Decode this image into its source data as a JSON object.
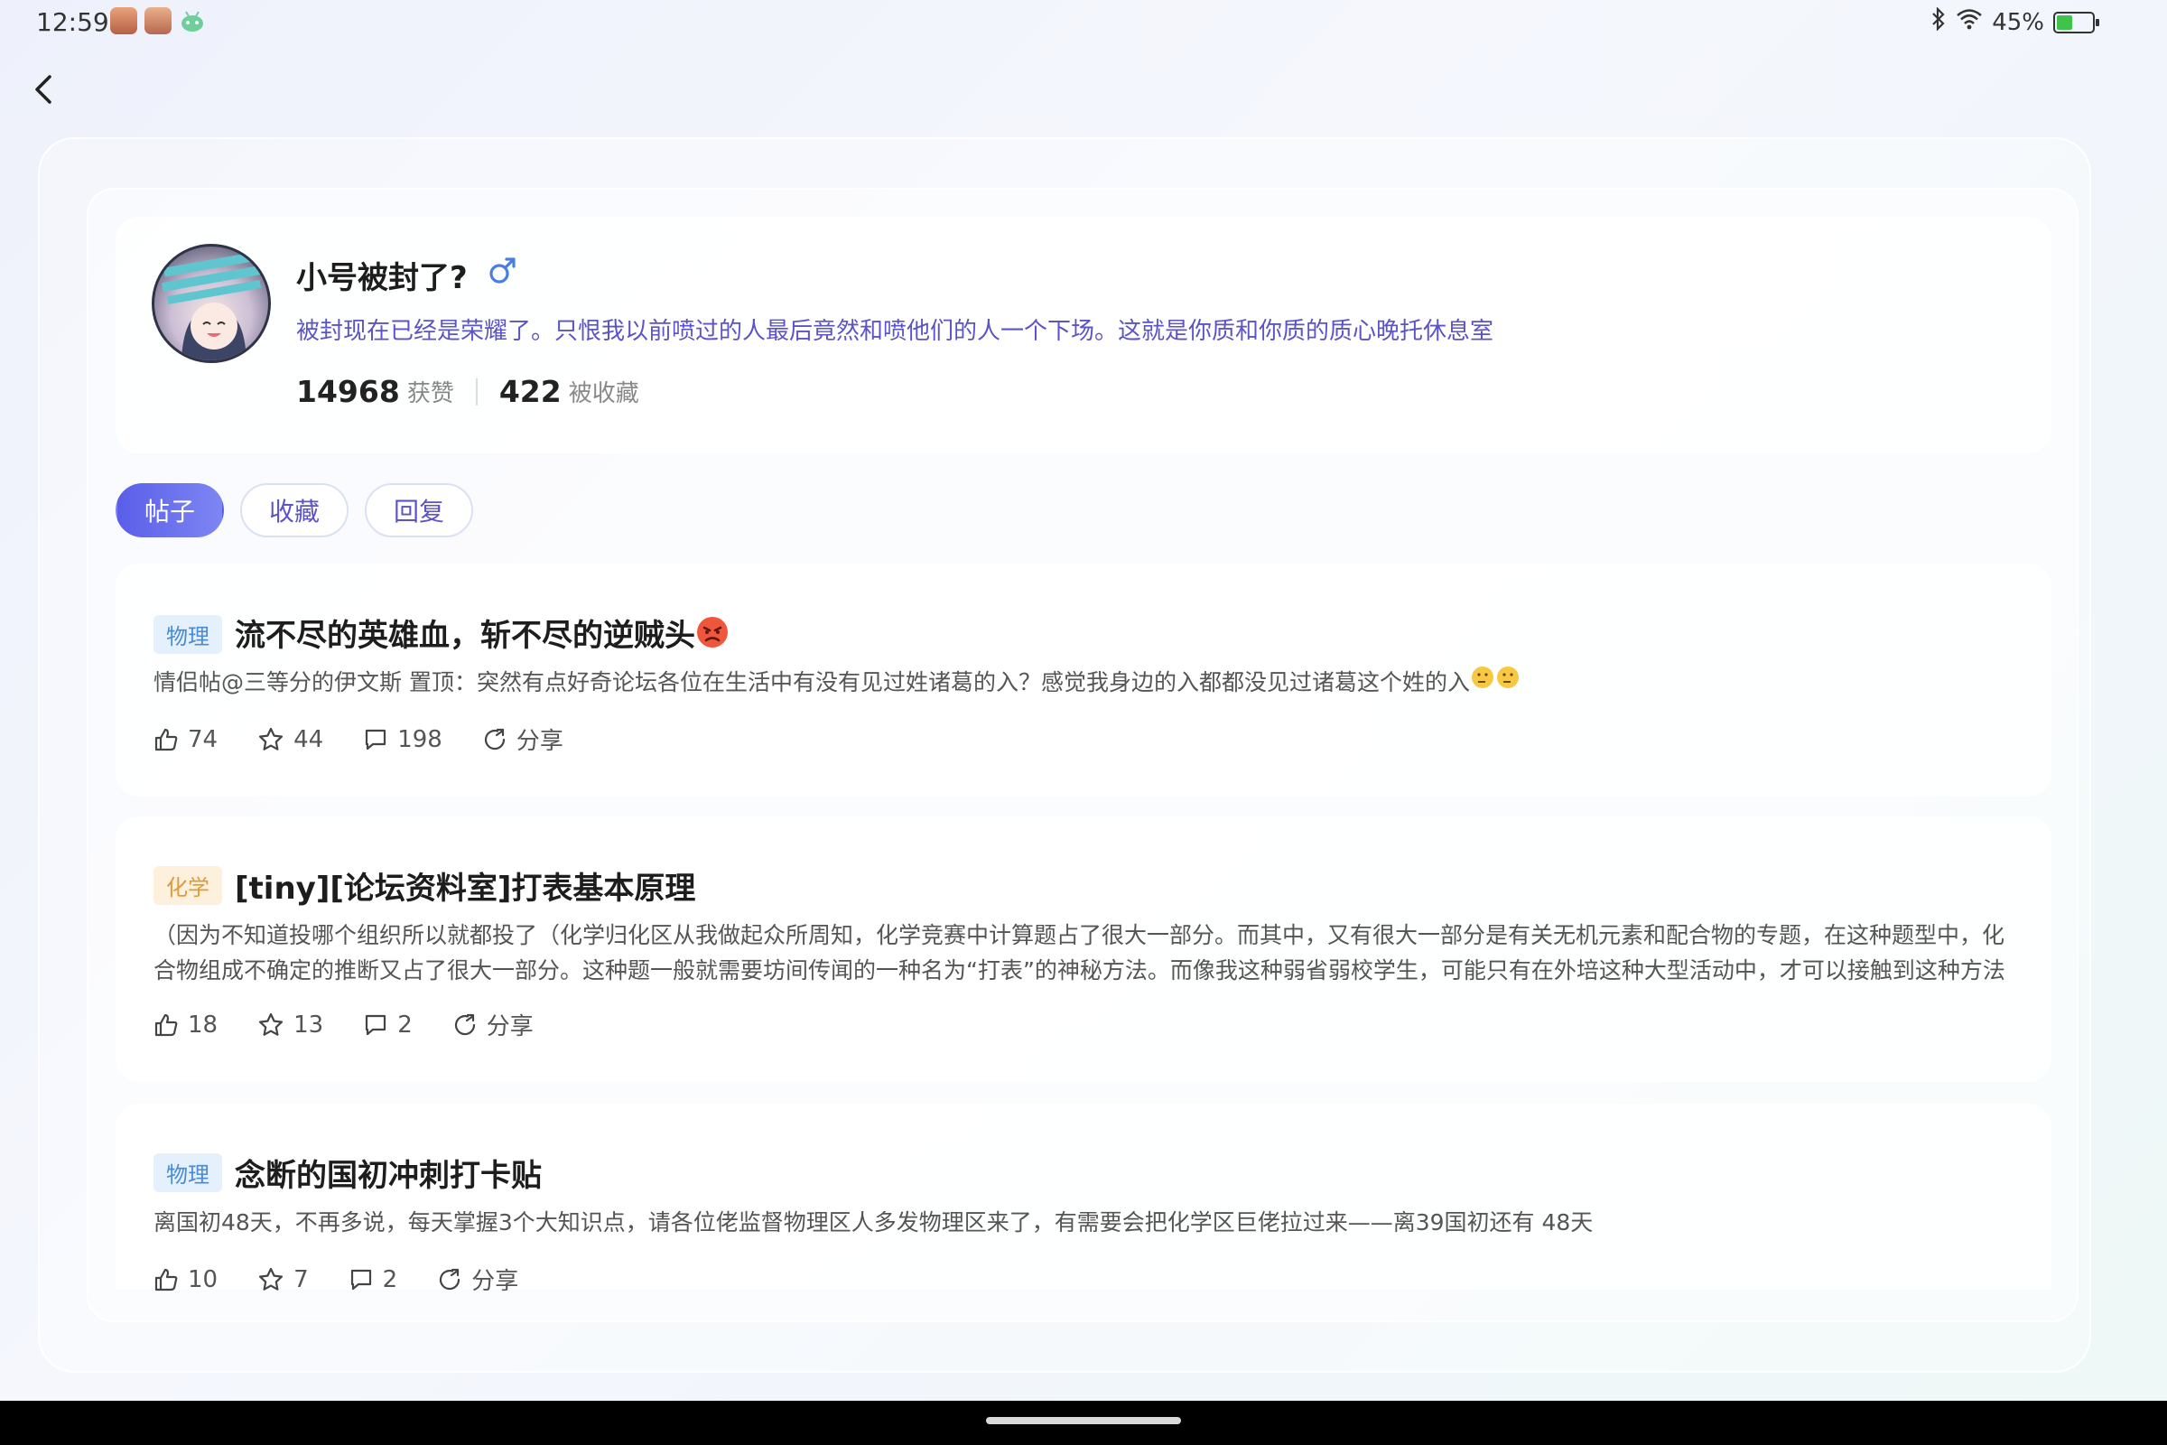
{
  "status_bar": {
    "time": "12:59",
    "battery_percent": "45%",
    "battery_level": 0.45
  },
  "profile": {
    "username": "小号被封了?",
    "gender": "♂",
    "bio": "被封现在已经是荣耀了。只恨我以前喷过的人最后竟然和喷他们的人一个下场。这就是你质和你质的质心晚托休息室",
    "likes_count": "14968",
    "likes_label": "获赞",
    "favorites_count": "422",
    "favorites_label": "被收藏"
  },
  "tabs": [
    {
      "label": "帖子",
      "active": true
    },
    {
      "label": "收藏",
      "active": false
    },
    {
      "label": "回复",
      "active": false
    }
  ],
  "posts": [
    {
      "tag": "物理",
      "title": "流不尽的英雄血，斩不尽的逆贼头",
      "body": "情侣帖@三等分的伊文斯 置顶：突然有点好奇论坛各位在生活中有没有见过姓诸葛的入？感觉我身边的入都都没见过诸葛这个姓的入",
      "likes": "74",
      "favorites": "44",
      "comments": "198",
      "share": "分享"
    },
    {
      "tag": "化学",
      "title": "[tiny][论坛资料室]打表基本原理",
      "body": "（因为不知道投哪个组织所以就都投了（化学归化区从我做起众所周知，化学竞赛中计算题占了很大一部分。而其中，又有很大一部分是有关无机元素和配合物的专题，在这种题型中，化合物组成不确定的推断又占了很大一部分。这种题一般就需要坊间传闻的一种名为“打表”的神秘方法。而像我这种弱省弱校学生，可能只有在外培这种大型活动中，才可以接触到这种方法",
      "likes": "18",
      "favorites": "13",
      "comments": "2",
      "share": "分享"
    },
    {
      "tag": "物理",
      "title": "念断的国初冲刺打卡贴",
      "body": "离国初48天，不再多说，每天掌握3个大知识点，请各位佬监督物理区人多发物理区来了，有需要会把化学区巨佬拉过来——离39国初还有 48天",
      "likes": "10",
      "favorites": "7",
      "comments": "2",
      "share": "分享"
    }
  ]
}
